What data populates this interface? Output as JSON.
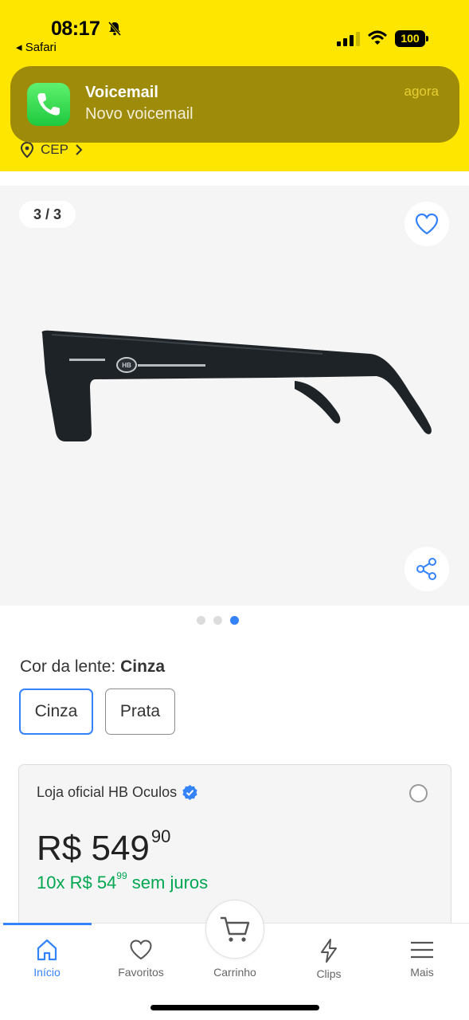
{
  "status_bar": {
    "time": "08:17",
    "back_app": "◂ Safari",
    "battery": "100"
  },
  "notification": {
    "app": "Voicemail",
    "message": "Novo voicemail",
    "time": "agora",
    "icon": "phone-icon"
  },
  "header": {
    "cep_label": "CEP"
  },
  "gallery": {
    "counter": "3 / 3",
    "current_index": 3,
    "total": 3
  },
  "lens": {
    "label": "Cor da lente: ",
    "selected": "Cinza",
    "options": [
      "Cinza",
      "Prata"
    ]
  },
  "offer": {
    "store": "Loja oficial HB Oculos",
    "price_main": "R$ 549",
    "price_cents": "90",
    "installment_prefix": "10x R$ 54",
    "installment_cents": "99",
    "installment_suffix": " sem juros"
  },
  "nav": {
    "items": [
      {
        "label": "Início",
        "icon": "home-icon",
        "active": true
      },
      {
        "label": "Favoritos",
        "icon": "heart-icon",
        "active": false
      },
      {
        "label": "Carrinho",
        "icon": "cart-icon",
        "active": false
      },
      {
        "label": "Clips",
        "icon": "lightning-icon",
        "active": false
      },
      {
        "label": "Mais",
        "icon": "menu-icon",
        "active": false
      }
    ]
  },
  "colors": {
    "brand_yellow": "#ffe600",
    "accent_blue": "#3483fa",
    "installment_green": "#00a650"
  }
}
